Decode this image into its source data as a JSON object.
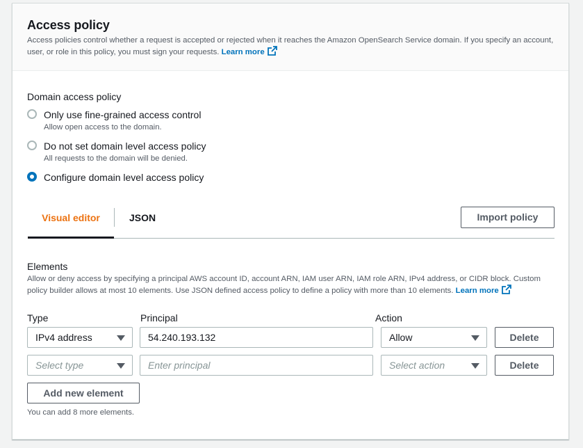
{
  "header": {
    "title": "Access policy",
    "description": "Access policies control whether a request is accepted or rejected when it reaches the Amazon OpenSearch Service domain. If you specify an account, user, or role in this policy, you must sign your requests.",
    "learn_more": "Learn more"
  },
  "domain_access": {
    "label": "Domain access policy",
    "options": [
      {
        "label": "Only use fine-grained access control",
        "description": "Allow open access to the domain.",
        "selected": false
      },
      {
        "label": "Do not set domain level access policy",
        "description": "All requests to the domain will be denied.",
        "selected": false
      },
      {
        "label": "Configure domain level access policy",
        "description": "",
        "selected": true
      }
    ]
  },
  "tabs": {
    "visual": "Visual editor",
    "json": "JSON",
    "import_label": "Import policy"
  },
  "elements": {
    "label": "Elements",
    "description": "Allow or deny access by specifying a principal AWS account ID, account ARN, IAM user ARN, IAM role ARN, IPv4 address, or CIDR block. Custom policy builder allows at most 10 elements. Use JSON defined access policy to define a policy with more than 10 elements.",
    "learn_more": "Learn more",
    "columns": {
      "type": "Type",
      "principal": "Principal",
      "action": "Action"
    },
    "rows": [
      {
        "type": "IPv4 address",
        "principal": "54.240.193.132",
        "action": "Allow",
        "delete": "Delete"
      },
      {
        "type_placeholder": "Select type",
        "principal_placeholder": "Enter principal",
        "action_placeholder": "Select action",
        "delete": "Delete"
      }
    ],
    "add_label": "Add new element",
    "hint": "You can add 8 more elements."
  },
  "colors": {
    "accent": "#ec7211",
    "link": "#0073bb",
    "radio_selected": "#0073bb"
  }
}
